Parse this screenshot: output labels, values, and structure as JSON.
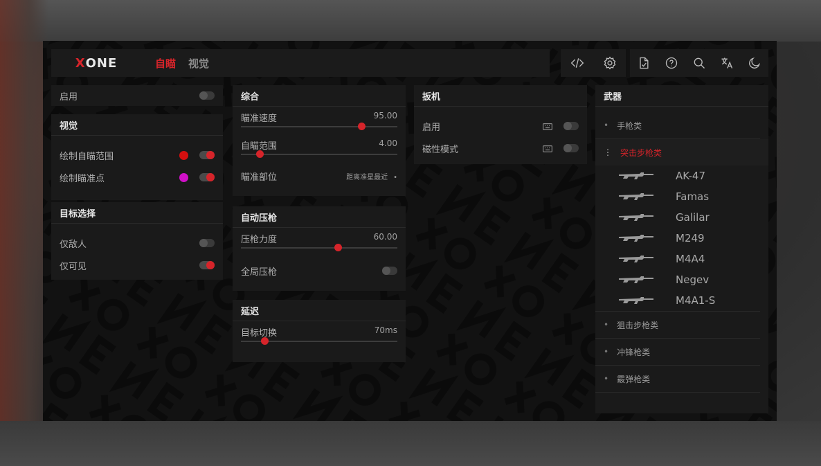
{
  "logo": {
    "x": "X",
    "rest": "ONE"
  },
  "tabs": [
    {
      "label": "自瞄",
      "active": true
    },
    {
      "label": "视觉",
      "active": false
    }
  ],
  "toolbar_icons": [
    "code-icon",
    "gear-icon",
    "document-icon",
    "help-icon",
    "search-icon",
    "translate-icon",
    "moon-icon"
  ],
  "colors": {
    "accent": "#d6242a",
    "red_dot": "#d40f0f",
    "magenta_dot": "#d010c8"
  },
  "left": {
    "enable": {
      "label": "启用",
      "on": false
    },
    "visual": {
      "title": "视觉",
      "rows": [
        {
          "label": "绘制自瞄范围",
          "color": "#d40f0f",
          "on": true
        },
        {
          "label": "绘制瞄准点",
          "color": "#d010c8",
          "on": true
        }
      ]
    },
    "target": {
      "title": "目标选择",
      "rows": [
        {
          "label": "仅敌人",
          "on": false
        },
        {
          "label": "仅可见",
          "on": true
        }
      ]
    }
  },
  "middle": {
    "general": {
      "title": "综合",
      "speed": {
        "label": "瞄准速度",
        "value": "95.00",
        "fraction": 0.77
      },
      "fov": {
        "label": "自瞄范围",
        "value": "4.00",
        "fraction": 0.12
      },
      "bone": {
        "label": "瞄准部位",
        "value": "距离准星最近"
      }
    },
    "recoil": {
      "title": "自动压枪",
      "strength": {
        "label": "压枪力度",
        "value": "60.00",
        "fraction": 0.62
      },
      "global": {
        "label": "全局压枪",
        "on": false
      }
    },
    "delay": {
      "title": "延迟",
      "switch": {
        "label": "目标切换",
        "value": "70ms",
        "fraction": 0.15
      }
    }
  },
  "trigger": {
    "title": "扳机",
    "rows": [
      {
        "label": "启用",
        "on": false
      },
      {
        "label": "磁性模式",
        "on": false
      }
    ]
  },
  "weapons": {
    "title": "武器",
    "categories": {
      "pistols": "手枪类",
      "rifles": "突击步枪类",
      "snipers": "狙击步枪类",
      "smgs": "冲锋枪类",
      "shotguns": "霰弹枪类"
    },
    "rifles": [
      "AK-47",
      "Famas",
      "Galilar",
      "M249",
      "M4A4",
      "Negev",
      "M4A1-S"
    ]
  }
}
